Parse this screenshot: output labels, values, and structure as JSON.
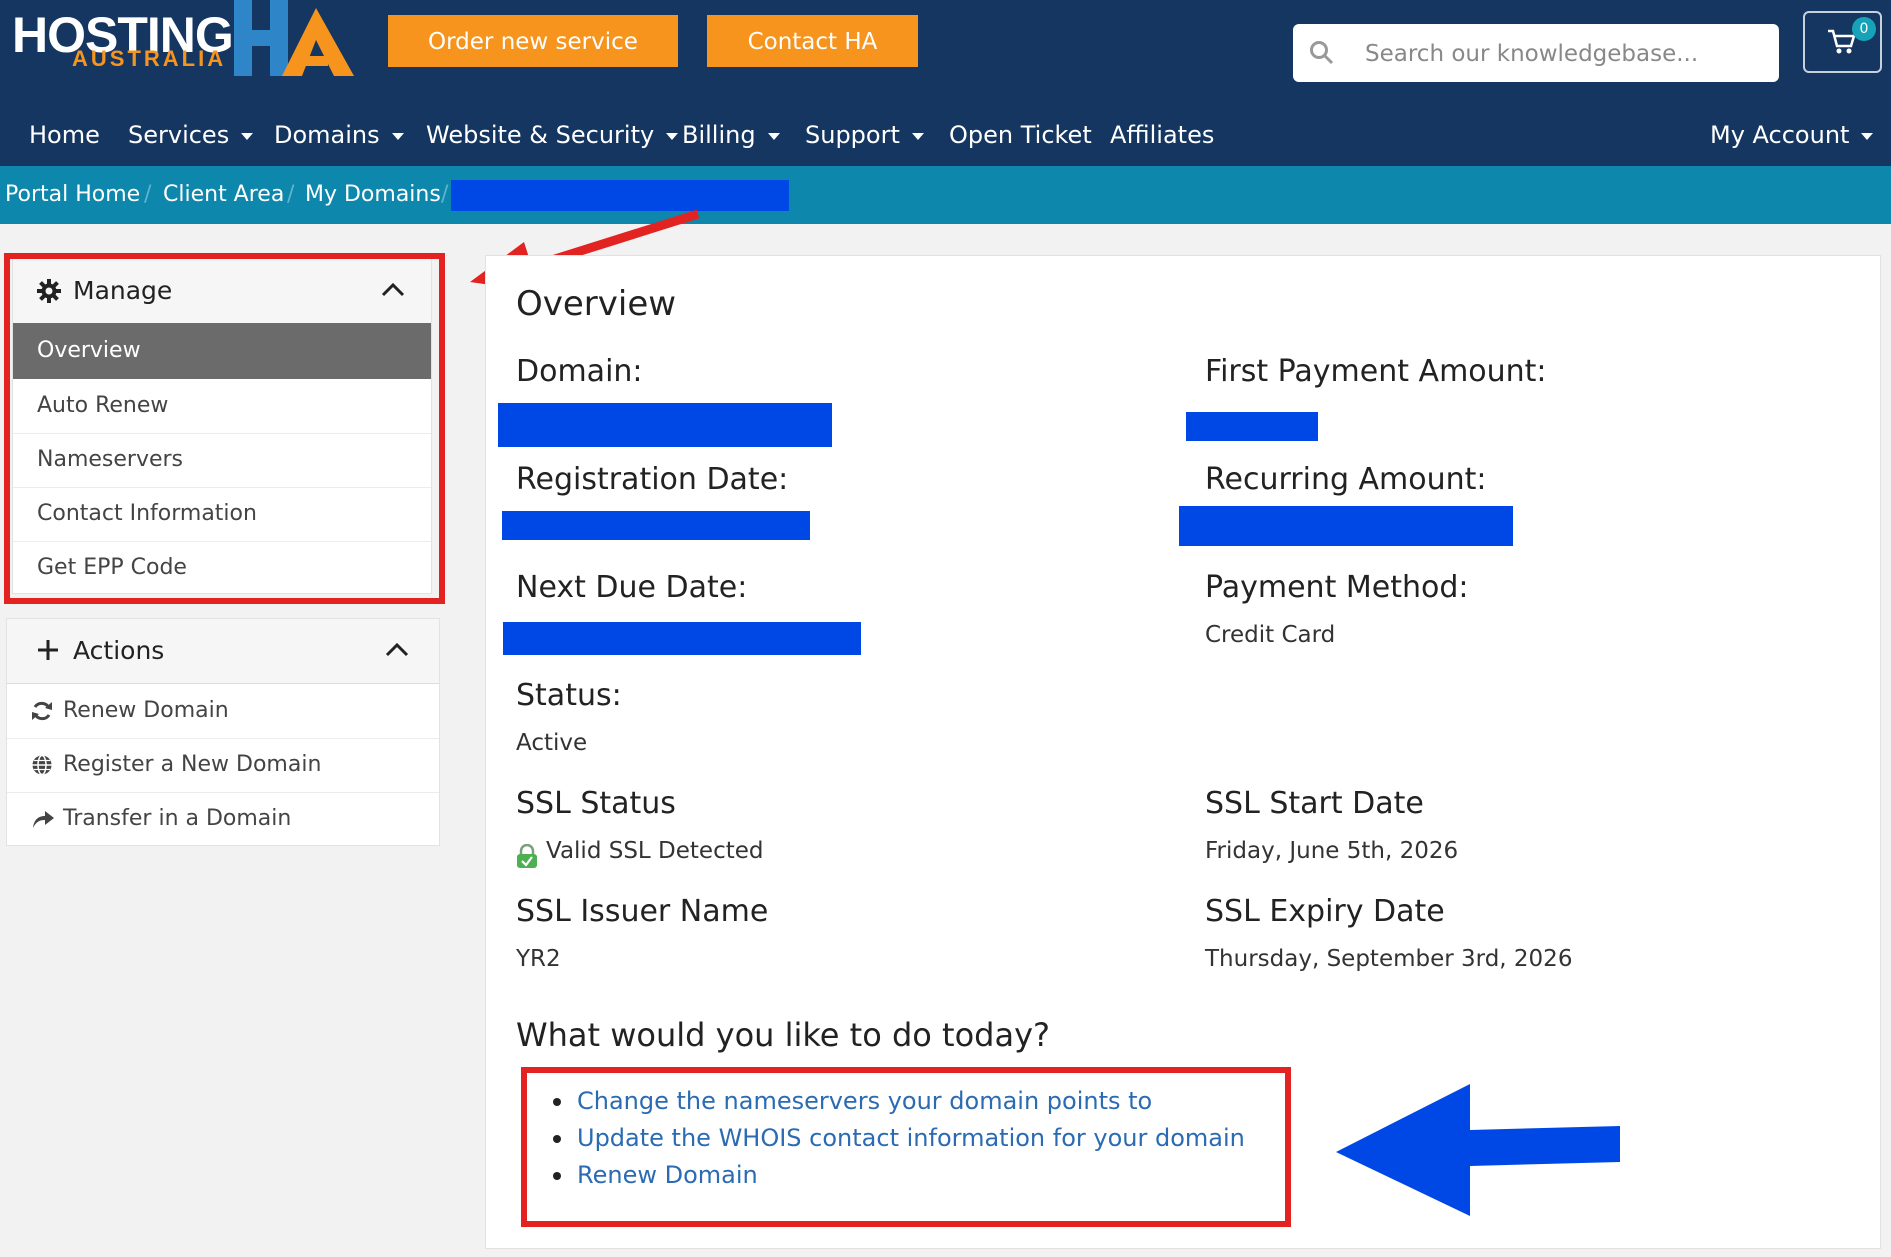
{
  "header": {
    "logo_text_main": "HOSTING",
    "logo_text_sub": "AUSTRALIA",
    "logo_mark": "HA",
    "order_button": "Order new service",
    "contact_button": "Contact HA",
    "search_placeholder": "Search our knowledgebase...",
    "cart_count": "0",
    "cart_icon": "shopping-cart-icon"
  },
  "nav": {
    "items": [
      "Home",
      "Services",
      "Domains",
      "Website & Security",
      "Billing",
      "Support",
      "Open Ticket",
      "Affiliates"
    ],
    "account": "My Account"
  },
  "breadcrumb": [
    "Portal Home",
    "Client Area",
    "My Domains"
  ],
  "sidebar": {
    "manage": {
      "title": "Manage",
      "icon": "gear-icon",
      "items": [
        "Overview",
        "Auto Renew",
        "Nameservers",
        "Contact Information",
        "Get EPP Code"
      ],
      "active": "Overview"
    },
    "actions": {
      "title": "Actions",
      "icon": "plus-icon",
      "items": [
        {
          "label": "Renew Domain",
          "icon": "refresh-icon"
        },
        {
          "label": "Register a New Domain",
          "icon": "globe-icon"
        },
        {
          "label": "Transfer in a Domain",
          "icon": "share-arrow-icon"
        }
      ]
    }
  },
  "overview": {
    "title": "Overview",
    "domain_label": "Domain:",
    "first_payment_label": "First Payment Amount:",
    "registration_label": "Registration Date:",
    "recurring_label": "Recurring Amount:",
    "next_due_label": "Next Due Date:",
    "payment_method_label": "Payment Method:",
    "payment_method_value": "Credit Card",
    "status_label": "Status:",
    "status_value": "Active",
    "ssl_status_label": "SSL Status",
    "ssl_status_value": "Valid SSL Detected",
    "ssl_start_label": "SSL Start Date",
    "ssl_start_value": "Friday, June 5th, 2026",
    "ssl_issuer_label": "SSL Issuer Name",
    "ssl_issuer_value": "YR2",
    "ssl_expiry_label": "SSL Expiry Date",
    "ssl_expiry_value": "Thursday, September 3rd, 2026"
  },
  "todo": {
    "title": "What would you like to do today?",
    "links": [
      "Change the nameservers your domain points to",
      "Update the WHOIS contact information for your domain",
      "Renew Domain"
    ]
  },
  "colors": {
    "header_bg": "#143660",
    "accent_orange": "#f7941d",
    "breadcrumb_bg": "#0d87ab",
    "annotation_red": "#e32222",
    "annotation_blue": "#0048e6",
    "link_blue": "#2a6bb3"
  }
}
